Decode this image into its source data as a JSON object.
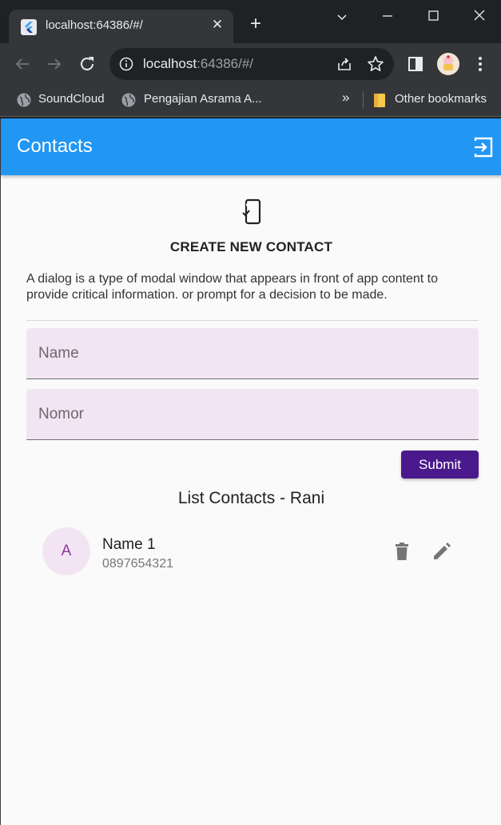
{
  "browser": {
    "tab": {
      "title": "localhost:64386/#/",
      "close_glyph": "✕"
    },
    "new_tab_glyph": "+",
    "window": {
      "minimize": "—",
      "maximize": "☐",
      "close": "✕",
      "tab_search": "⌄"
    },
    "url": {
      "host": "localhost",
      "rest": ":64386/#/"
    },
    "bookmarks": [
      {
        "label": "SoundCloud",
        "icon": "globe-icon"
      },
      {
        "label": "Pengajian Asrama A...",
        "icon": "globe-icon"
      }
    ],
    "bookmarks_overflow": "»",
    "other_bookmarks": "Other bookmarks"
  },
  "app": {
    "title": "Contacts",
    "accent": "#2196f3",
    "logout_icon": "logout-icon"
  },
  "form": {
    "icon": "phone-check-icon",
    "heading": "CREATE NEW CONTACT",
    "description": "A dialog is a type of modal window that appears in front of app content to provide critical information. or prompt for a decision to be made.",
    "name_placeholder": "Name",
    "number_placeholder": "Nomor",
    "submit_label": "Submit",
    "submit_color": "#4a1a8c"
  },
  "list": {
    "title": "List Contacts - Rani",
    "items": [
      {
        "avatar": "A",
        "name": "Name 1",
        "number": "0897654321"
      }
    ]
  }
}
